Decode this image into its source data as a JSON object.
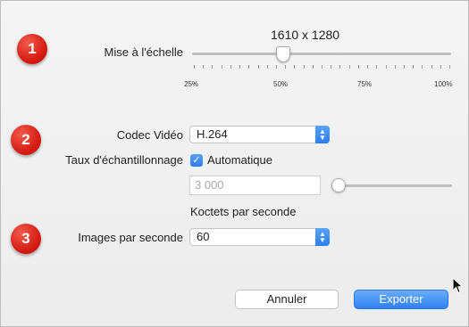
{
  "badges": [
    "1",
    "2",
    "3"
  ],
  "scale": {
    "resolution": "1610 x 1280",
    "label": "Mise à l'échelle",
    "ticks": [
      "25%",
      "50%",
      "75%",
      "100%"
    ],
    "value_percent": 50
  },
  "codec": {
    "label": "Codec Vidéo",
    "value": "H.264"
  },
  "sample_rate": {
    "label": "Taux d'échantillonnage",
    "checkbox_label": "Automatique",
    "checked": true,
    "input_placeholder": "3 000",
    "unit": "Koctets par seconde",
    "slider_value": 0
  },
  "fps": {
    "label": "Images par seconde",
    "value": "60"
  },
  "buttons": {
    "cancel": "Annuler",
    "export": "Exporter"
  },
  "colors": {
    "badge": "#d51a12",
    "accent": "#2f7ff2"
  }
}
